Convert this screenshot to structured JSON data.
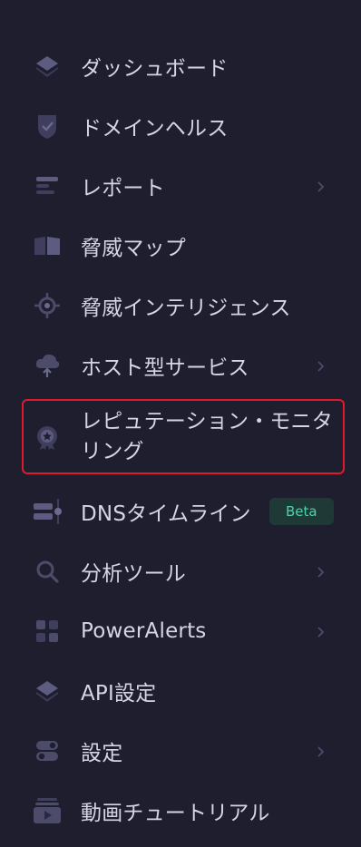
{
  "sidebar": {
    "items": [
      {
        "label": "ダッシュボード",
        "icon": "layers-icon",
        "has_chevron": false
      },
      {
        "label": "ドメインヘルス",
        "icon": "shield-check-icon",
        "has_chevron": false
      },
      {
        "label": "レポート",
        "icon": "report-bars-icon",
        "has_chevron": true
      },
      {
        "label": "脅威マップ",
        "icon": "map-book-icon",
        "has_chevron": false
      },
      {
        "label": "脅威インテリジェンス",
        "icon": "crosshair-icon",
        "has_chevron": false
      },
      {
        "label": "ホスト型サービス",
        "icon": "cloud-upload-icon",
        "has_chevron": true
      },
      {
        "label": "レピュテーション・モニタリング",
        "icon": "star-badge-icon",
        "has_chevron": false,
        "active": true
      },
      {
        "label": "DNSタイムライン",
        "icon": "timeline-icon",
        "has_chevron": false,
        "badge": "Beta"
      },
      {
        "label": "分析ツール",
        "icon": "search-icon",
        "has_chevron": true
      },
      {
        "label": "PowerAlerts",
        "icon": "grid-icon",
        "has_chevron": true
      },
      {
        "label": "API設定",
        "icon": "layers-icon",
        "has_chevron": false
      },
      {
        "label": "設定",
        "icon": "toggle-icon",
        "has_chevron": true
      },
      {
        "label": "動画チュートリアル",
        "icon": "video-icon",
        "has_chevron": false
      }
    ]
  },
  "colors": {
    "background": "#1f1e2e",
    "text": "#d6d5e3",
    "icon": "#4c4b6a",
    "icon_light": "#6b6a8e",
    "active_border": "#e0192d",
    "badge_bg": "#1f3a36",
    "badge_text": "#4fd1a8"
  }
}
